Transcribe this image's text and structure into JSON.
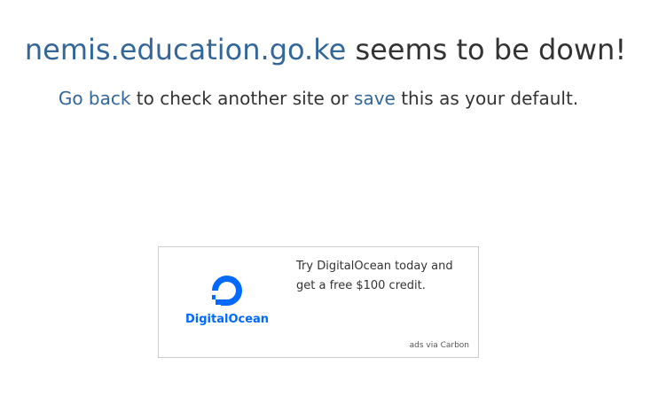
{
  "headline": {
    "domain": "nemis.education.go.ke",
    "status": " seems to be down!"
  },
  "subline": {
    "go_back": "Go back",
    "middle": " to check another site or ",
    "save": "save",
    "end": " this as your default."
  },
  "ad": {
    "brand": "DigitalOcean",
    "text": "Try DigitalOcean today and get a free $100 credit.",
    "via": "ads via Carbon",
    "logo_icon": "digitalocean-logo-icon",
    "brand_color": "#0069ff"
  },
  "colors": {
    "link": "#336699",
    "text": "#333333"
  }
}
